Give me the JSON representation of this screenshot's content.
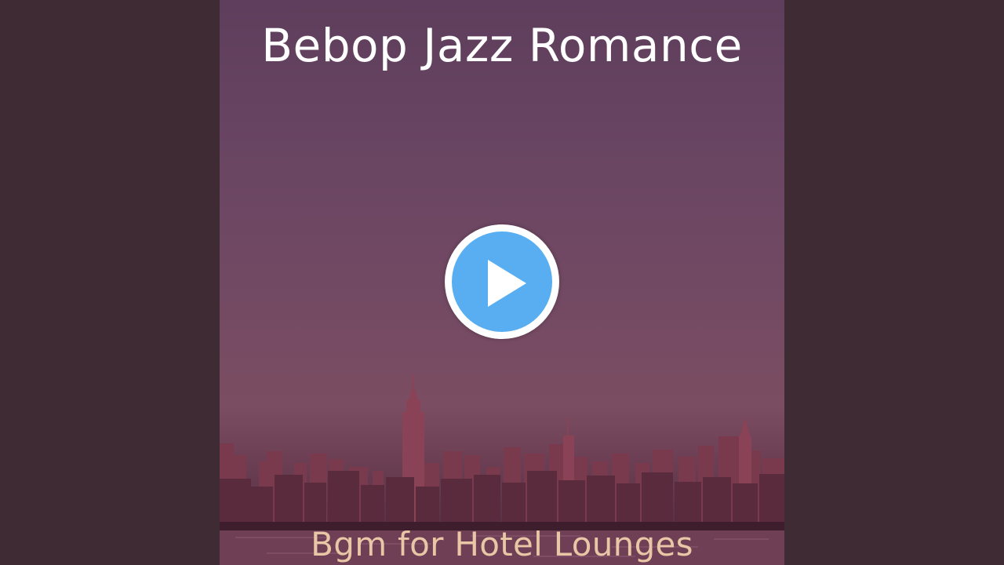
{
  "video": {
    "title": "Bebop Jazz Romance",
    "subtitle": "Bgm for Hotel Lounges"
  },
  "controls": {
    "play_icon": "play-icon"
  },
  "colors": {
    "side_background": "#3f2b33",
    "play_circle": "#58aef0",
    "title_text": "#ffffff",
    "subtitle_text": "#e9c7a6"
  }
}
